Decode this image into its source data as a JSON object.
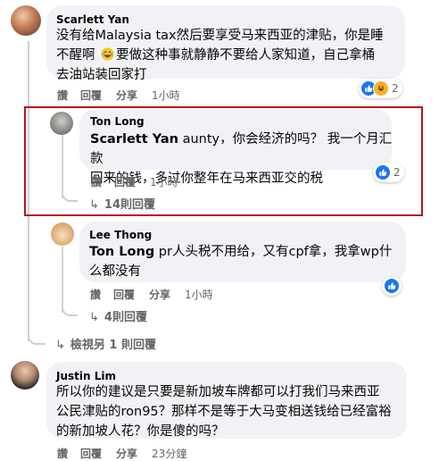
{
  "comments": [
    {
      "author": "Scarlett Yan",
      "line1": "没有给Malaysia tax然后要享受马来西亚的津贴，你是睡",
      "line2a": "不醒啊",
      "line2b": "要做这种事就静静不要给人家知道，自己拿桶",
      "line3": "去油站装回家打",
      "like": "讚",
      "reply": "回覆",
      "share": "分享",
      "time": "1小時",
      "reactions_count": "2"
    },
    {
      "author": "Ton Long",
      "mention": "Scarlett Yan",
      "line1_rest": " aunty，你会经济的吗？ 我一个月汇款",
      "line2": "回来的钱，多过你整年在马来西亚交的税",
      "like": "讚",
      "reply": "回覆",
      "time": "1小時",
      "reactions_count": "2",
      "replies_label": "14則回覆"
    },
    {
      "author": "Lee Thong",
      "mention": "Ton Long",
      "line1_rest": " pr人头税不用给，又有cpf拿，我拿wp什",
      "line2": "么都没有",
      "like": "讚",
      "reply": "回覆",
      "share": "分享",
      "time": "1小時",
      "replies_label": "4則回覆"
    },
    {
      "author": "Justin Lim",
      "line1": "所以你的建议是只要是新加坡车牌都可以打我们马来西亚",
      "line2": "公民津贴的ron95？那样不是等于大马变相送钱给已经富裕",
      "line3": "的新加坡人花？你是傻的吗？",
      "like": "讚",
      "reply": "回覆",
      "share": "分享",
      "time": "23分鐘"
    }
  ],
  "view_more_replies": "檢視另 1 則回覆",
  "colors": {
    "bubble": "#f0f2f5",
    "meta_text": "#65676b",
    "highlight_border": "#b4171d",
    "like_blue": "#1877f2",
    "haha_yellow": "#f7b125"
  }
}
